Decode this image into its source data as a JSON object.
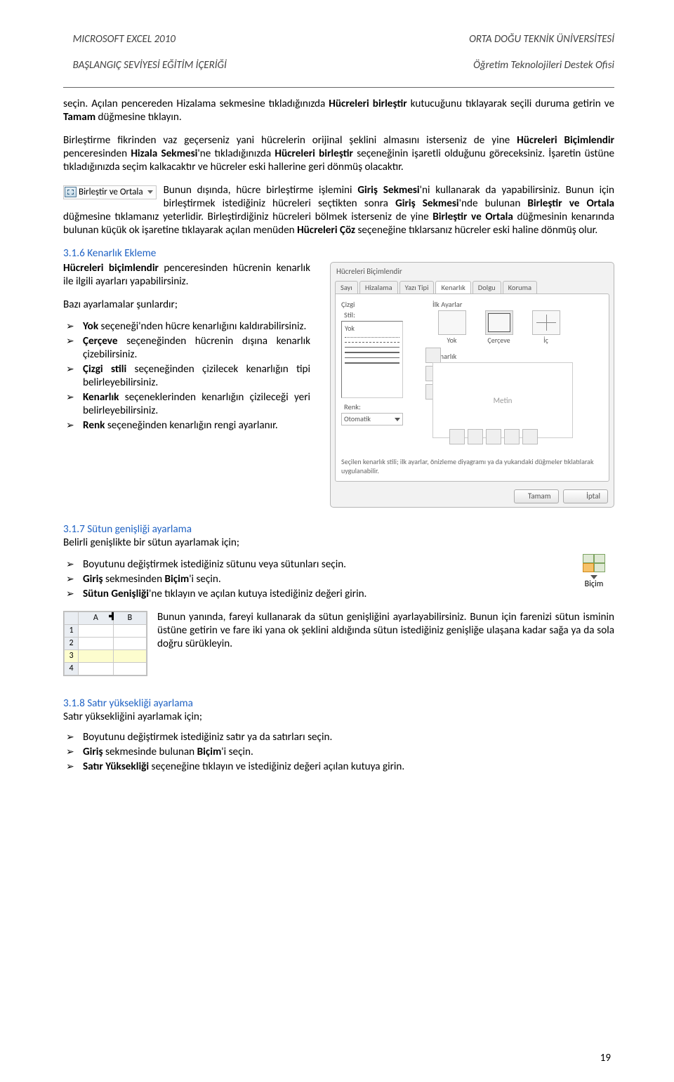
{
  "header": {
    "left_line1": "MICROSOFT EXCEL 2010",
    "left_line2": "BAŞLANGIÇ SEVİYESİ EĞİTİM İÇERİĞİ",
    "right_line1": "ORTA DOĞU TEKNİK ÜNİVERSİTESİ",
    "right_line2": "Öğretim Teknolojileri Destek Ofisi"
  },
  "paragraphs": {
    "p1_a": "seçin. Açılan pencereden Hizalama sekmesine tıkladığınızda ",
    "p1_b": "Hücreleri birleştir",
    "p1_c": " kutucuğunu tıklayarak seçili duruma getirin ve ",
    "p1_d": "Tamam",
    "p1_e": " düğmesine tıklayın.",
    "p2_a": "Birleştirme fikrinden vaz geçerseniz yani hücrelerin orijinal şeklini almasını isterseniz de yine ",
    "p2_b": "Hücreleri Biçimlendir",
    "p2_c": " penceresinden ",
    "p2_d": "Hizala Sekmesi",
    "p2_e": "'ne tıkladığınızda ",
    "p2_f": "Hücreleri birleştir",
    "p2_g": " seçeneğinin işaretli olduğunu göreceksiniz. İşaretin üstüne tıkladığınızda seçim kalkacaktır ve hücreler eski hallerine geri dönmüş olacaktır.",
    "merge_btn_label": "Birleştir ve Ortala",
    "p3_a": "Bunun dışında, hücre birleştirme işlemini ",
    "p3_b": "Giriş Sekmesi",
    "p3_c": "'ni kullanarak da yapabilirsiniz. Bunun için birleştirmek istediğiniz hücreleri seçtikten sonra ",
    "p3_d": "Giriş Sekmesi",
    "p3_e": "'nde bulunan ",
    "p3_f": "Birleştir ve Ortala",
    "p3_g": " düğmesine tıklamanız yeterlidir. Birleştirdiğiniz hücreleri bölmek isterseniz de yine ",
    "p3_h": "Birleştir ve Ortala",
    "p3_i": " düğmesinin kenarında bulunan küçük ok işaretine tıklayarak açılan menüden ",
    "p3_j": "Hücreleri Çöz",
    "p3_k": " seçeneğine tıklarsanız hücreler eski haline dönmüş olur."
  },
  "sections": {
    "s316_title": "3.1.6 Kenarlık Ekleme",
    "s316_intro_a": "Hücreleri biçimlendir",
    "s316_intro_b": " penceresinden hücrenin kenarlık ile ilgili ayarları yapabilirsiniz.",
    "s316_sub": "Bazı ayarlamalar şunlardır;",
    "s316_items": [
      {
        "a": "Yok",
        "b": " seçeneği'nden hücre kenarlığını kaldırabilirsiniz."
      },
      {
        "a": "Çerçeve",
        "b": " seçeneğinden hücrenin dışına kenarlık çizebilirsiniz."
      },
      {
        "a": "Çizgi stili",
        "b": " seçeneğinden çizilecek kenarlığın tipi belirleyebilirsiniz."
      },
      {
        "a": "Kenarlık",
        "b": " seçeneklerinden kenarlığın çizileceği yeri belirleyebilirsiniz."
      },
      {
        "a": "Renk",
        "b": " seçeneğinden kenarlığın rengi ayarlanır."
      }
    ],
    "s317_title": "3.1.7 Sütun genişliği ayarlama",
    "s317_intro": "Belirli genişlikte bir sütun ayarlamak için;",
    "s317_items": [
      "Boyutunu değiştirmek istediğiniz sütunu veya sütunları seçin.",
      "",
      ""
    ],
    "s317_item2_a": "Giriş",
    "s317_item2_b": " sekmesinden ",
    "s317_item2_c": "Biçim",
    "s317_item2_d": "'i seçin.",
    "s317_item3_a": "Sütun Genişliği",
    "s317_item3_b": "'ne tıklayın ve açılan kutuya istediğiniz değeri girin.",
    "bicim_label": "Biçim",
    "s317_para": "Bunun yanında, fareyi kullanarak da sütun genişliğini ayarlayabilirsiniz. Bunun için farenizi sütun isminin üstüne getirin ve fare iki yana ok şeklini aldığında sütun istediğiniz genişliğe ulaşana kadar sağa ya da sola doğru sürükleyin.",
    "cols": {
      "a": "A",
      "b": "B"
    },
    "rows": [
      "1",
      "2",
      "3",
      "4"
    ],
    "s318_title": "3.1.8 Satır yüksekliği ayarlama",
    "s318_intro": "Satır yüksekliğini ayarlamak için;",
    "s318_item1": "Boyutunu değiştirmek istediğiniz satır ya da satırları seçin.",
    "s318_item2_a": "Giriş",
    "s318_item2_b": " sekmesinde bulunan ",
    "s318_item2_c": "Biçim",
    "s318_item2_d": "'i seçin.",
    "s318_item3_a": "Satır Yüksekliği",
    "s318_item3_b": " seçeneğine tıklayın ve istediğiniz değeri açılan kutuya girin."
  },
  "dialog": {
    "title": "Hücreleri Biçimlendir",
    "tabs": [
      "Sayı",
      "Hizalama",
      "Yazı Tipi",
      "Kenarlık",
      "Dolgu",
      "Koruma"
    ],
    "group_line": "Çizgi",
    "group_presets": "İlk Ayarlar",
    "style": "Stil:",
    "none_opt": "Yok",
    "color": "Renk:",
    "color_val": "Otomatik",
    "presets": [
      "Yok",
      "Çerçeve",
      "İç"
    ],
    "group_border": "Kenarlık",
    "preview_text": "Metin",
    "hint": "Seçilen kenarlık stili; ilk ayarlar, önizleme diyagramı ya da yukarıdaki düğmeler tıklatılarak uygulanabilir.",
    "ok": "Tamam",
    "cancel": "İptal"
  },
  "page_number": "19"
}
